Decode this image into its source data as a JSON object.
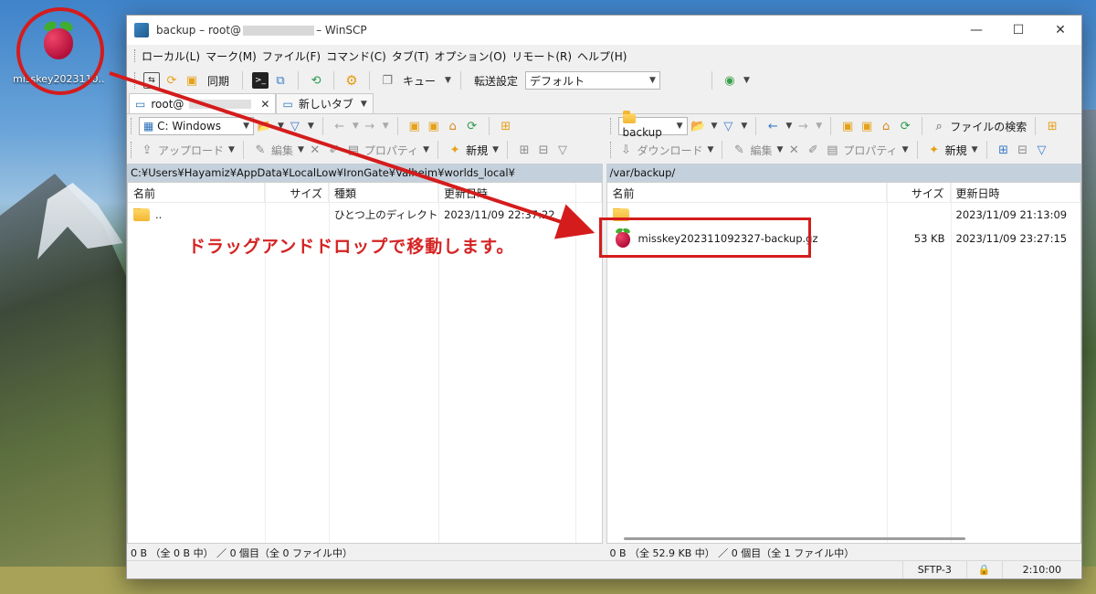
{
  "desktop": {
    "icon_label": "misskey2023110..."
  },
  "window": {
    "title_prefix": "backup – root@",
    "title_suffix": "– WinSCP"
  },
  "menu": [
    "ローカル(L)",
    "マーク(M)",
    "ファイル(F)",
    "コマンド(C)",
    "タブ(T)",
    "オプション(O)",
    "リモート(R)",
    "ヘルプ(H)"
  ],
  "toolbar": {
    "sync_label": "同期",
    "queue_label": "キュー",
    "transfer_label": "転送設定",
    "transfer_value": "デフォルト"
  },
  "tabs": {
    "session_tab": "root@",
    "new_tab": "新しいタブ"
  },
  "local": {
    "drive": "C: Windows",
    "upload_label": "アップロード",
    "edit_label": "編集",
    "properties_label": "プロパティ",
    "new_label": "新規",
    "path": "C:¥Users¥Hayamiz¥AppData¥LocalLow¥IronGate¥Valheim¥worlds_local¥",
    "headers": {
      "name": "名前",
      "size": "サイズ",
      "type": "種類",
      "modified": "更新日時"
    },
    "rows": [
      {
        "name": "..",
        "size": "",
        "type": "ひとつ上のディレクトリ",
        "modified": "2023/11/09 22:37:22"
      }
    ],
    "status": "0 B （全 0 B 中） ／ 0 個目（全 0 ファイル中）"
  },
  "remote": {
    "folder": "backup",
    "find_label": "ファイルの検索",
    "download_label": "ダウンロード",
    "edit_label": "編集",
    "properties_label": "プロパティ",
    "new_label": "新規",
    "path": "/var/backup/",
    "headers": {
      "name": "名前",
      "size": "サイズ",
      "modified": "更新日時"
    },
    "rows": [
      {
        "name": "",
        "size": "",
        "modified": "2023/11/09 21:13:09"
      },
      {
        "name": "misskey202311092327-backup.gz",
        "size": "53 KB",
        "modified": "2023/11/09 23:27:15"
      }
    ],
    "status": "0 B （全 52.9 KB 中） ／ 0 個目（全 1 ファイル中）"
  },
  "statusbar": {
    "protocol": "SFTP-3",
    "time": "2:10:00"
  },
  "annotation": {
    "text": "ドラッグアンドドロップで移動します。"
  },
  "colors": {
    "annotation_red": "#d41c1c",
    "path_bar": "#c4d0db"
  }
}
